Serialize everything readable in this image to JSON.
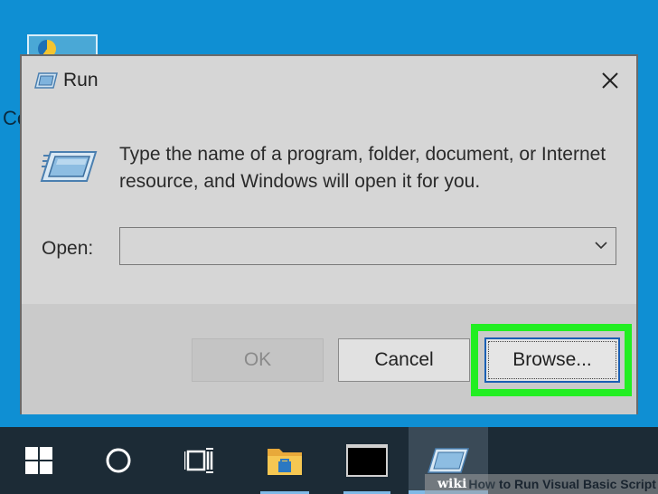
{
  "desktop": {
    "icon_label": "Co"
  },
  "dialog": {
    "title": "Run",
    "description": "Type the name of a program, folder, document, or Internet resource, and Windows will open it for you.",
    "open_label": "Open:",
    "open_value": "",
    "buttons": {
      "ok": "OK",
      "cancel": "Cancel",
      "browse": "Browse..."
    },
    "highlight_color": "#22ee22"
  },
  "taskbar": {
    "items": [
      {
        "icon": "windows-logo-icon"
      },
      {
        "icon": "cortana-search-icon"
      },
      {
        "icon": "task-view-icon"
      },
      {
        "icon": "file-explorer-icon"
      },
      {
        "icon": "command-prompt-icon"
      },
      {
        "icon": "run-icon",
        "active": true
      }
    ]
  },
  "watermark": {
    "brand": "wiki",
    "how": "How",
    "title": "to Run Visual Basic Script"
  },
  "colors": {
    "desktop": "#0f8fd3",
    "taskbar": "#1c2b36",
    "dialog": "#d6d6d6",
    "accent": "#1a5fb4"
  }
}
